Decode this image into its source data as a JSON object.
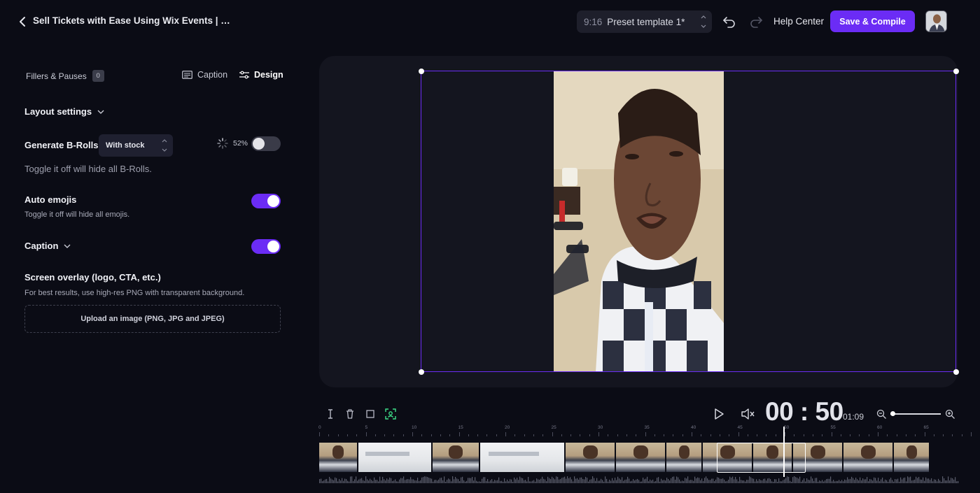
{
  "header": {
    "project_title": "Sell Tickets with Ease Using Wix Events | Creat...",
    "preset_ratio": "9:16",
    "preset_name": "Preset template 1*",
    "help_center": "Help Center",
    "save_label": "Save & Compile"
  },
  "left_panel": {
    "fillers_label": "Fillers & Pauses",
    "fillers_count": "0",
    "tabs": [
      {
        "label": "Caption",
        "active": false
      },
      {
        "label": "Design",
        "active": true
      }
    ],
    "layout_settings": "Layout settings",
    "broll": {
      "title": "Generate B-Rolls",
      "select_value": "With stock",
      "progress": "52%",
      "progress_value": 52,
      "enabled": false,
      "hint": "Toggle it off will hide all B-Rolls."
    },
    "emoji": {
      "title": "Auto emojis",
      "enabled": true,
      "hint": "Toggle it off will hide all emojis."
    },
    "caption": {
      "title": "Caption",
      "enabled": true
    },
    "overlay": {
      "title": "Screen overlay (logo, CTA, etc.)",
      "hint": "For best results, use high-res PNG with transparent background.",
      "upload_label": "Upload an image (PNG, JPG and JPEG)"
    }
  },
  "timeline": {
    "timecode": "00 : 50",
    "duration": "01:09",
    "ruler_labels": [
      "0",
      "5",
      "10",
      "15",
      "20",
      "25",
      "30",
      "35",
      "40",
      "45",
      "50",
      "55",
      "60",
      "65"
    ]
  },
  "colors": {
    "accent": "#6b2cf5",
    "background": "#0b0c15",
    "panel": "#14151f"
  }
}
